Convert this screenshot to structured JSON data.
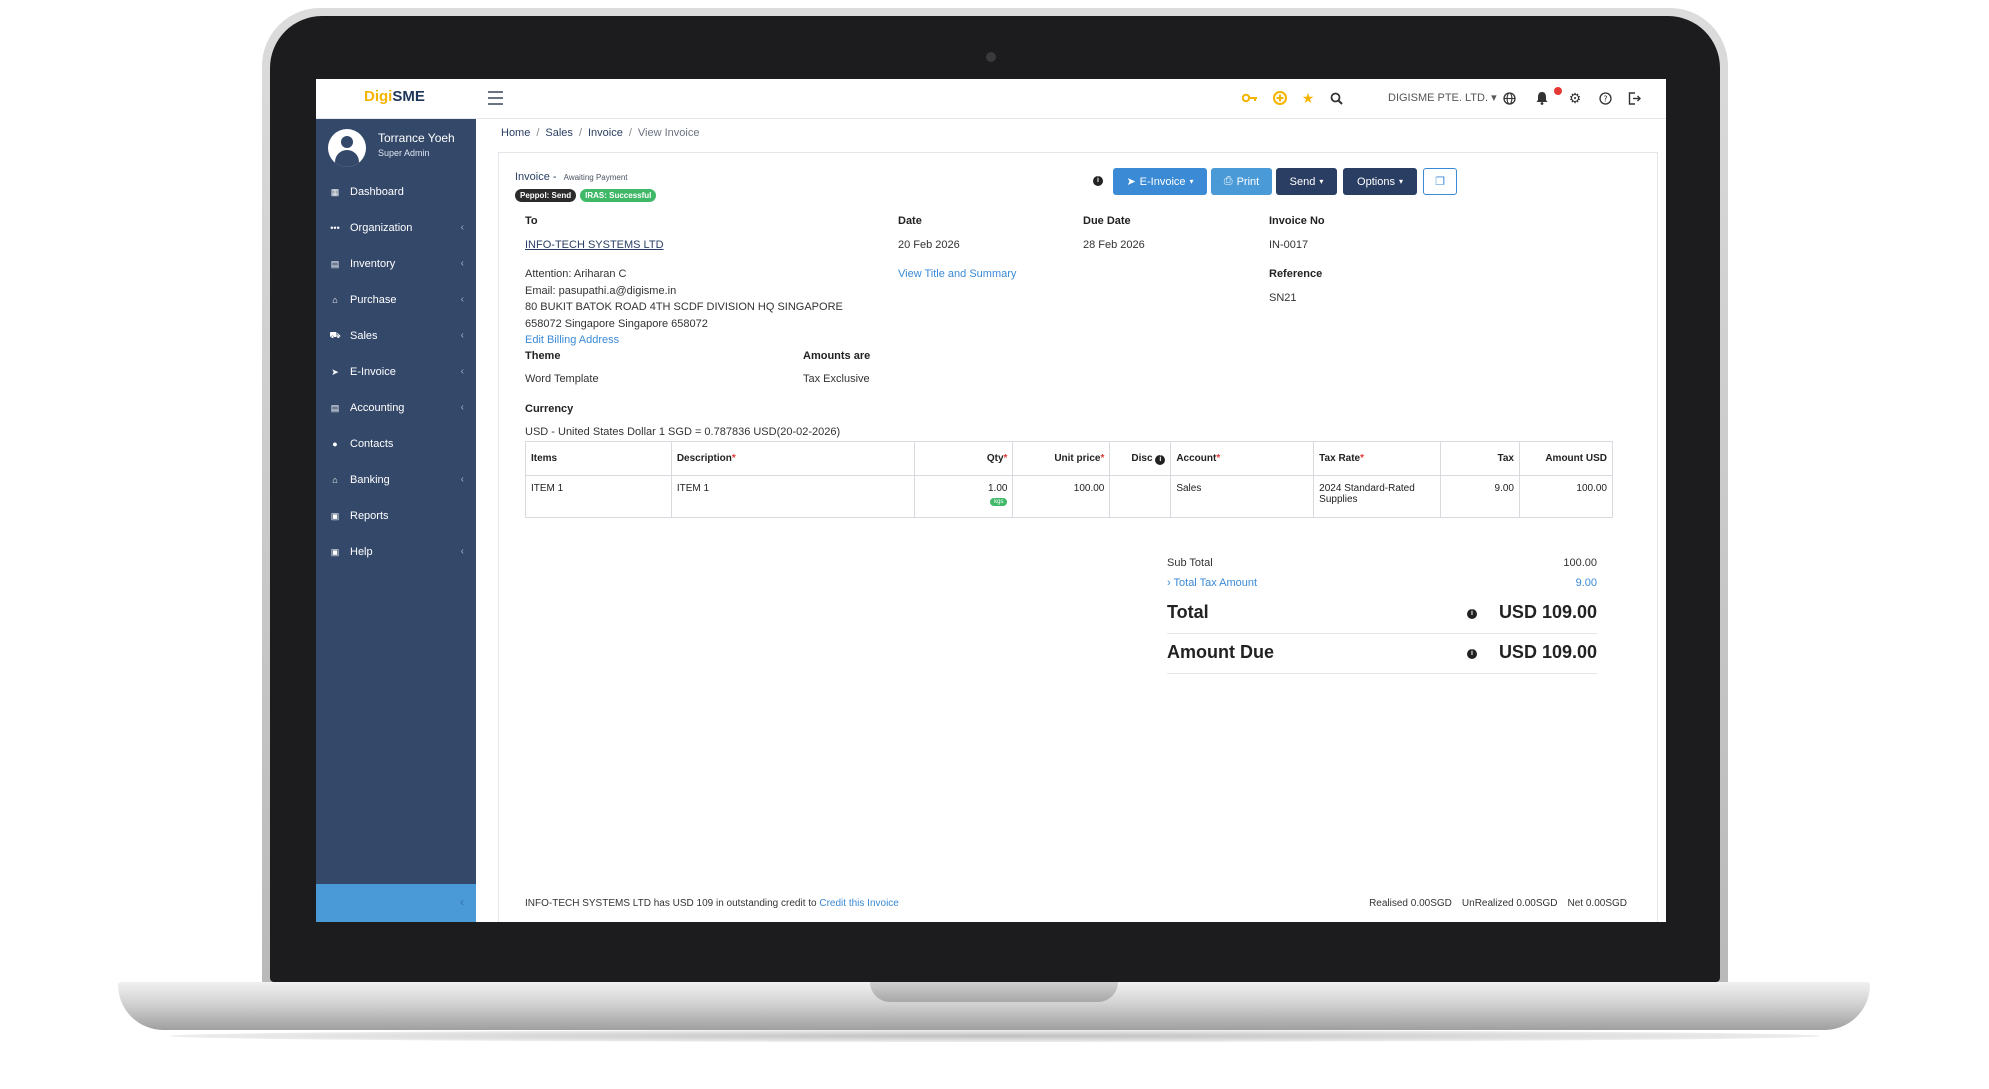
{
  "app": {
    "logo_part1": "Digi",
    "logo_part2": "SME"
  },
  "topbar": {
    "company": "DIGISME PTE. LTD.",
    "company_caret": "▾",
    "icons": [
      "key-icon",
      "plus-circle-icon",
      "star-icon",
      "search-icon",
      "globe-icon",
      "bell-icon",
      "gear-icon",
      "help-icon",
      "logout-icon"
    ]
  },
  "user": {
    "name": "Torrance Yoeh",
    "role": "Super Admin"
  },
  "sidebar": {
    "items": [
      {
        "label": "Dashboard",
        "icon": "dashboard-icon",
        "chevron": ""
      },
      {
        "label": "Organization",
        "icon": "organization-icon",
        "chevron": "‹"
      },
      {
        "label": "Inventory",
        "icon": "inventory-icon",
        "chevron": "‹"
      },
      {
        "label": "Purchase",
        "icon": "purchase-icon",
        "chevron": "‹"
      },
      {
        "label": "Sales",
        "icon": "cart-icon",
        "chevron": "‹"
      },
      {
        "label": "E-Invoice",
        "icon": "einvoice-icon",
        "chevron": "‹"
      },
      {
        "label": "Accounting",
        "icon": "accounting-icon",
        "chevron": "‹"
      },
      {
        "label": "Contacts",
        "icon": "contacts-icon",
        "chevron": ""
      },
      {
        "label": "Banking",
        "icon": "bank-icon",
        "chevron": "‹"
      },
      {
        "label": "Reports",
        "icon": "reports-icon",
        "chevron": ""
      },
      {
        "label": "Help",
        "icon": "help-icon",
        "chevron": "‹"
      }
    ],
    "collapse_glyph": "‹"
  },
  "breadcrumb": {
    "home": "Home",
    "sales": "Sales",
    "invoice": "Invoice",
    "current": "View Invoice",
    "sep": "/"
  },
  "invoice": {
    "title": "Invoice -",
    "status": "Awaiting Payment",
    "badges": {
      "peppol": "Peppol: Send",
      "iras": "IRAS: Successful"
    },
    "buttons": {
      "einvoice": "E-Invoice",
      "print": "Print",
      "send": "Send",
      "options": "Options",
      "caret": "▾"
    },
    "to_label": "To",
    "to_value": "INFO-TECH SYSTEMS LTD",
    "date_label": "Date",
    "date_value": "20 Feb 2026",
    "due_label": "Due Date",
    "due_value": "28 Feb 2026",
    "no_label": "Invoice No",
    "no_value": "IN-0017",
    "view_title": "View Title and Summary",
    "ref_label": "Reference",
    "ref_value": "SN21",
    "attention": "Attention: Ariharan C",
    "email": "Email: pasupathi.a@digisme.in",
    "address1": "80 BUKIT BATOK ROAD 4TH SCDF DIVISION HQ SINGAPORE",
    "address2": "658072 Singapore Singapore 658072",
    "edit_billing": "Edit Billing Address",
    "theme_label": "Theme",
    "theme_value": "Word Template",
    "amounts_label": "Amounts are",
    "amounts_value": "Tax Exclusive",
    "currency_label": "Currency",
    "currency_value": "USD - United States Dollar 1 SGD = 0.787836 USD(20-02-2026)"
  },
  "table": {
    "headers": {
      "items": "Items",
      "description": "Description",
      "qty": "Qty",
      "unit_price": "Unit price",
      "disc": "Disc",
      "account": "Account",
      "tax_rate": "Tax Rate",
      "tax": "Tax",
      "amount": "Amount USD",
      "req": "*"
    },
    "rows": [
      {
        "item": "ITEM 1",
        "description": "ITEM 1",
        "qty": "1.00",
        "unit": "kgs",
        "unit_price": "100.00",
        "disc": "",
        "account": "Sales",
        "tax_rate": "2024 Standard-Rated Supplies",
        "tax": "9.00",
        "amount": "100.00"
      }
    ]
  },
  "totals": {
    "subtotal_label": "Sub Total",
    "subtotal_value": "100.00",
    "tax_label": "› Total Tax Amount",
    "tax_value": "9.00",
    "total_label": "Total",
    "total_value": "USD 109.00",
    "due_label": "Amount Due",
    "due_value": "USD 109.00"
  },
  "footer": {
    "credit_text": "INFO-TECH SYSTEMS LTD has USD 109 in outstanding credit to",
    "credit_link": "Credit this Invoice",
    "realised": "Realised 0.00SGD",
    "unrealized": "UnRealized 0.00SGD",
    "net": "Net 0.00SGD"
  },
  "colors": {
    "sidebar": "#34486a",
    "accent_blue": "#3a8ad6",
    "button_dark": "#2a3e63",
    "badge_green": "#3fb868",
    "logo_yellow": "#f5b400"
  }
}
